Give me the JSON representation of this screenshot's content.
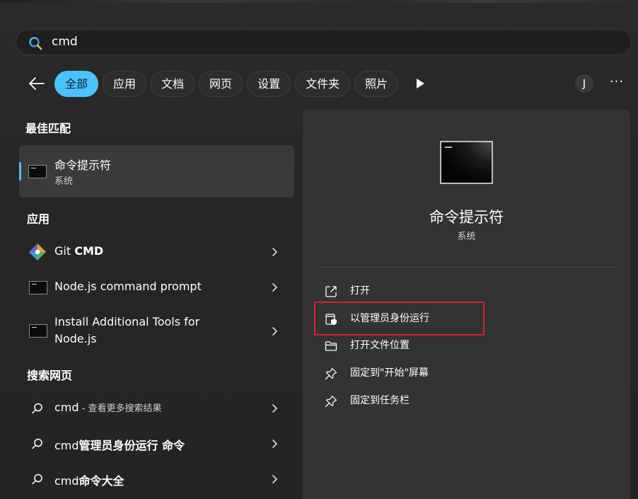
{
  "search": {
    "query": "cmd"
  },
  "filters": [
    "全部",
    "应用",
    "文档",
    "网页",
    "设置",
    "文件夹",
    "照片"
  ],
  "account": {
    "initial": "J"
  },
  "more": "···",
  "left": {
    "best_title": "最佳匹配",
    "best": {
      "name": "命令提示符",
      "subtitle": "系统"
    },
    "apps_title": "应用",
    "apps": [
      {
        "prefix": "Git ",
        "bold": "CMD"
      },
      {
        "label": "Node.js command prompt"
      },
      {
        "line1": "Install Additional Tools for",
        "line2": "Node.js"
      }
    ],
    "web_title": "搜索网页",
    "web": [
      {
        "query": "cmd",
        "suffix": " - 查看更多搜索结果"
      },
      {
        "query": "cmd",
        "bold": "管理员身份运行 命令"
      },
      {
        "query": "cmd",
        "bold": "命令大全"
      }
    ]
  },
  "detail": {
    "title": "命令提示符",
    "subtitle": "系统",
    "actions": [
      {
        "label": "打开",
        "icon": "open-external-icon"
      },
      {
        "label": "以管理员身份运行",
        "icon": "shield-admin-icon"
      },
      {
        "label": "打开文件位置",
        "icon": "folder-icon"
      },
      {
        "label": "固定到\"开始\"屏幕",
        "icon": "pin-icon"
      },
      {
        "label": "固定到任务栏",
        "icon": "pin-icon"
      }
    ]
  },
  "colors": {
    "accent": "#4cc2ff",
    "highlight": "#d4232b"
  }
}
